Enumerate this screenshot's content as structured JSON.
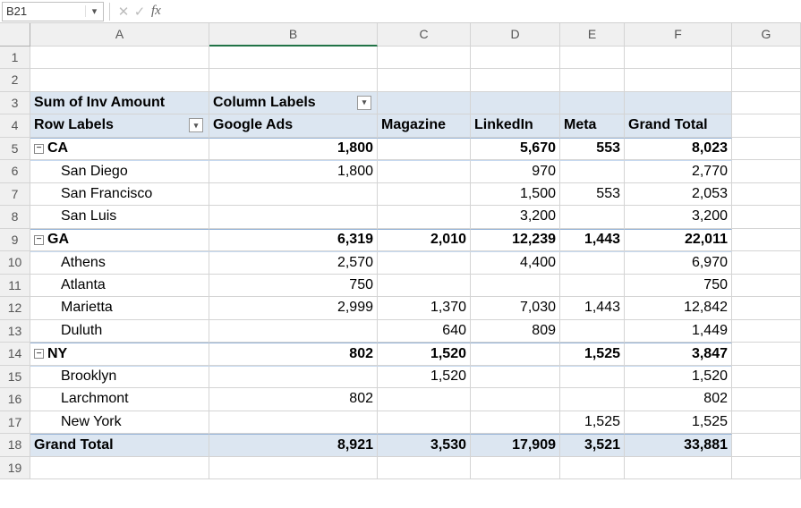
{
  "namebox": {
    "value": "B21"
  },
  "formula": {
    "value": ""
  },
  "columns": [
    "A",
    "B",
    "C",
    "D",
    "E",
    "F",
    "G"
  ],
  "rownums": [
    1,
    2,
    3,
    4,
    5,
    6,
    7,
    8,
    9,
    10,
    11,
    12,
    13,
    14,
    15,
    16,
    17,
    18,
    19
  ],
  "labels": {
    "sum_of": "Sum of Inv Amount",
    "column_labels": "Column Labels",
    "row_labels": "Row Labels",
    "google": "Google Ads",
    "magazine": "Magazine",
    "linkedin": "LinkedIn",
    "meta": "Meta",
    "grand_total": "Grand Total"
  },
  "glyphs": {
    "chev": "▾",
    "minus": "−",
    "x": "✕",
    "check": "✓",
    "fx": "fx"
  },
  "pivot": {
    "CA": {
      "label": "CA",
      "google": "1,800",
      "magazine": "",
      "linkedin": "5,670",
      "meta": "553",
      "total": "8,023",
      "children": [
        {
          "label": "San Diego",
          "google": "1,800",
          "magazine": "",
          "linkedin": "970",
          "meta": "",
          "total": "2,770"
        },
        {
          "label": "San Francisco",
          "google": "",
          "magazine": "",
          "linkedin": "1,500",
          "meta": "553",
          "total": "2,053"
        },
        {
          "label": "San Luis",
          "google": "",
          "magazine": "",
          "linkedin": "3,200",
          "meta": "",
          "total": "3,200"
        }
      ]
    },
    "GA": {
      "label": "GA",
      "google": "6,319",
      "magazine": "2,010",
      "linkedin": "12,239",
      "meta": "1,443",
      "total": "22,011",
      "children": [
        {
          "label": "Athens",
          "google": "2,570",
          "magazine": "",
          "linkedin": "4,400",
          "meta": "",
          "total": "6,970"
        },
        {
          "label": "Atlanta",
          "google": "750",
          "magazine": "",
          "linkedin": "",
          "meta": "",
          "total": "750"
        },
        {
          "label": "Marietta",
          "google": "2,999",
          "magazine": "1,370",
          "linkedin": "7,030",
          "meta": "1,443",
          "total": "12,842"
        },
        {
          "label": "Duluth",
          "google": "",
          "magazine": "640",
          "linkedin": "809",
          "meta": "",
          "total": "1,449"
        }
      ]
    },
    "NY": {
      "label": "NY",
      "google": "802",
      "magazine": "1,520",
      "linkedin": "",
      "meta": "1,525",
      "total": "3,847",
      "children": [
        {
          "label": "Brooklyn",
          "google": "",
          "magazine": "1,520",
          "linkedin": "",
          "meta": "",
          "total": "1,520"
        },
        {
          "label": "Larchmont",
          "google": "802",
          "magazine": "",
          "linkedin": "",
          "meta": "",
          "total": "802"
        },
        {
          "label": "New York",
          "google": "",
          "magazine": "",
          "linkedin": "",
          "meta": "1,525",
          "total": "1,525"
        }
      ]
    },
    "grand": {
      "label": "Grand Total",
      "google": "8,921",
      "magazine": "3,530",
      "linkedin": "17,909",
      "meta": "3,521",
      "total": "33,881"
    }
  },
  "chart_data": {
    "type": "table",
    "title": "Sum of Inv Amount",
    "columns": [
      "Google Ads",
      "Magazine",
      "LinkedIn",
      "Meta",
      "Grand Total"
    ],
    "rows": [
      {
        "level": 0,
        "label": "CA",
        "values": [
          1800,
          null,
          5670,
          553,
          8023
        ]
      },
      {
        "level": 1,
        "label": "San Diego",
        "values": [
          1800,
          null,
          970,
          null,
          2770
        ]
      },
      {
        "level": 1,
        "label": "San Francisco",
        "values": [
          null,
          null,
          1500,
          553,
          2053
        ]
      },
      {
        "level": 1,
        "label": "San Luis",
        "values": [
          null,
          null,
          3200,
          null,
          3200
        ]
      },
      {
        "level": 0,
        "label": "GA",
        "values": [
          6319,
          2010,
          12239,
          1443,
          22011
        ]
      },
      {
        "level": 1,
        "label": "Athens",
        "values": [
          2570,
          null,
          4400,
          null,
          6970
        ]
      },
      {
        "level": 1,
        "label": "Atlanta",
        "values": [
          750,
          null,
          null,
          null,
          750
        ]
      },
      {
        "level": 1,
        "label": "Marietta",
        "values": [
          2999,
          1370,
          7030,
          1443,
          12842
        ]
      },
      {
        "level": 1,
        "label": "Duluth",
        "values": [
          null,
          640,
          809,
          null,
          1449
        ]
      },
      {
        "level": 0,
        "label": "NY",
        "values": [
          802,
          1520,
          null,
          1525,
          3847
        ]
      },
      {
        "level": 1,
        "label": "Brooklyn",
        "values": [
          null,
          1520,
          null,
          null,
          1520
        ]
      },
      {
        "level": 1,
        "label": "Larchmont",
        "values": [
          802,
          null,
          null,
          null,
          802
        ]
      },
      {
        "level": 1,
        "label": "New York",
        "values": [
          null,
          null,
          null,
          1525,
          1525
        ]
      },
      {
        "level": 0,
        "label": "Grand Total",
        "values": [
          8921,
          3530,
          17909,
          3521,
          33881
        ]
      }
    ]
  }
}
